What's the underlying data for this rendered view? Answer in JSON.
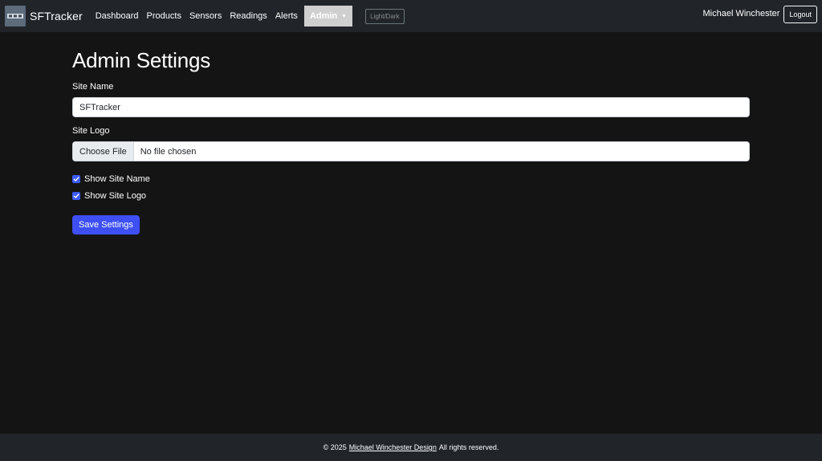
{
  "brand": {
    "name": "SFTracker",
    "logo_icon": "sft-logo-icon"
  },
  "nav": {
    "links": [
      "Dashboard",
      "Products",
      "Sensors",
      "Readings",
      "Alerts"
    ],
    "admin_label": "Admin",
    "theme_toggle": "Light/Dark"
  },
  "user": {
    "name": "Michael Winchester",
    "logout_label": "Logout"
  },
  "page": {
    "title": "Admin Settings",
    "site_name_label": "Site Name",
    "site_name_value": "SFTracker",
    "site_logo_label": "Site Logo",
    "file_button": "Choose File",
    "file_status": "No file chosen",
    "show_site_name_label": "Show Site Name",
    "show_site_name_checked": true,
    "show_site_logo_label": "Show Site Logo",
    "show_site_logo_checked": true,
    "save_label": "Save Settings"
  },
  "footer": {
    "prefix": "© 2025",
    "link": "Michael Winchester Design",
    "suffix": "All rights reserved."
  },
  "colors": {
    "background": "#141414",
    "navbar": "#212529",
    "accent": "#3d4ff5",
    "admin_active": "#cfcfcf"
  }
}
